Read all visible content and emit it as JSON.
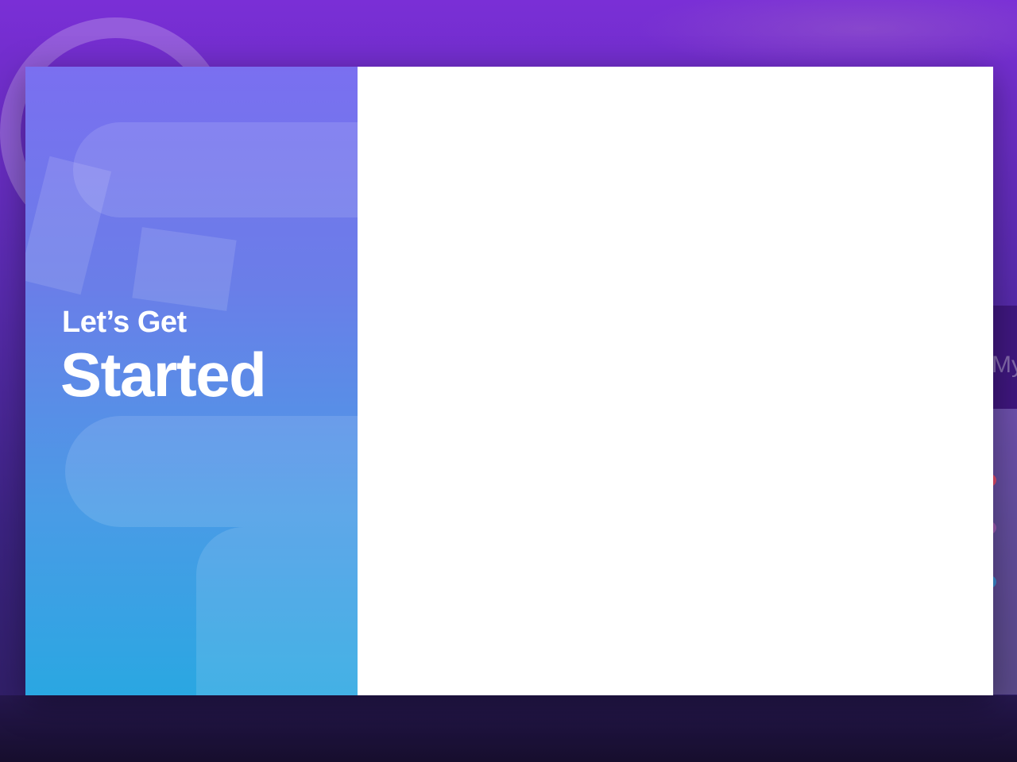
{
  "onboarding_modal": {
    "heading_line1": "Let’s Get",
    "heading_line2": "Started"
  },
  "background_app": {
    "partial_text": "My"
  },
  "colors": {
    "hero_gradient_top": "#7a6ff0",
    "hero_gradient_bottom": "#2aa7e2",
    "backdrop_purple": "#7a2fd6",
    "content_background": "#ffffff"
  }
}
